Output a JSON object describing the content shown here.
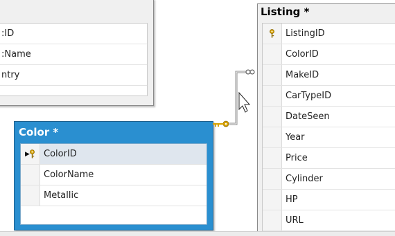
{
  "colors": {
    "selected_header": "#2a8fd0",
    "key_gold": "#d9a300"
  },
  "tables": {
    "left_partial": {
      "title": "",
      "columns": [
        ":ID",
        ":Name",
        "ntry"
      ]
    },
    "color": {
      "title": "Color *",
      "columns": [
        "ColorID",
        "ColorName",
        "Metallic"
      ],
      "primary_key": "ColorID"
    },
    "listing": {
      "title": "Listing *",
      "columns": [
        "ListingID",
        "ColorID",
        "MakeID",
        "CarTypeID",
        "DateSeen",
        "Year",
        "Price",
        "Cylinder",
        "HP",
        "URL"
      ],
      "primary_key": "ListingID"
    }
  },
  "icons": [
    "key-icon",
    "row-pointer-icon",
    "mouse-cursor-icon",
    "infinity-icon"
  ]
}
